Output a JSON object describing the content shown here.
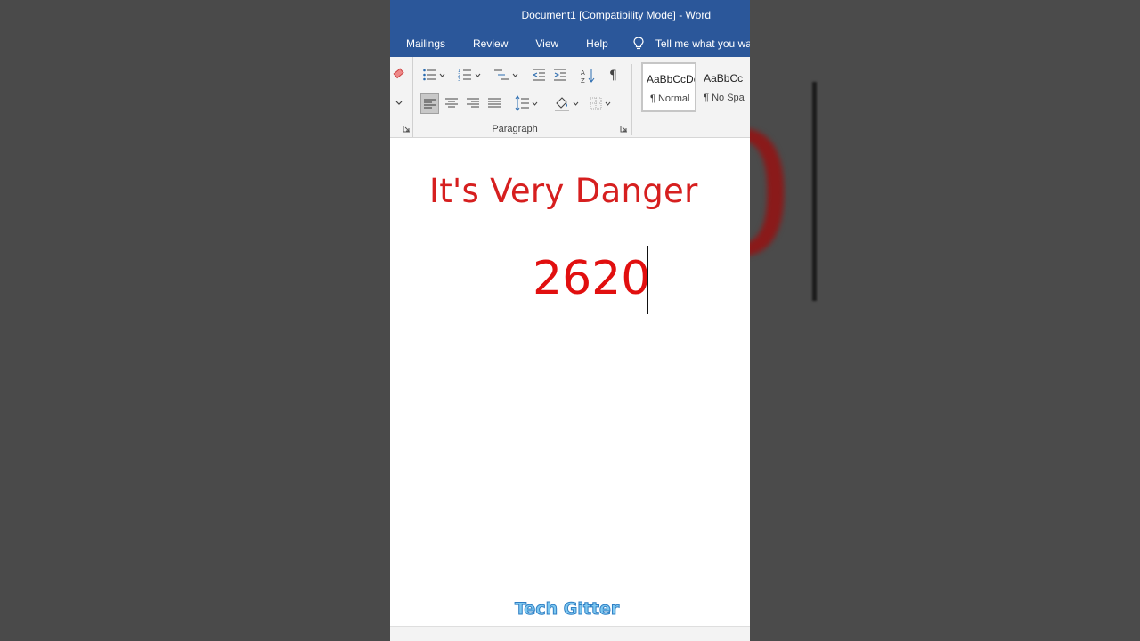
{
  "app": {
    "title": "Document1 [Compatibility Mode]  -  Word"
  },
  "menu": {
    "tabs": [
      "Mailings",
      "Review",
      "View",
      "Help"
    ],
    "tell_me": "Tell me what you want"
  },
  "ribbon": {
    "paragraph_group_label": "Paragraph",
    "styles": [
      {
        "sample": "AaBbCcDc",
        "name": "¶ Normal"
      },
      {
        "sample": "AaBbCc",
        "name": "¶ No Spa"
      }
    ]
  },
  "document": {
    "title": "It's Very Danger",
    "number": "2620"
  },
  "watermark": "Tech Gitter",
  "colors": {
    "titlebar": "#2b579a",
    "doc_text_red": "#e10f0f",
    "watermark": "#7ec8f0"
  }
}
